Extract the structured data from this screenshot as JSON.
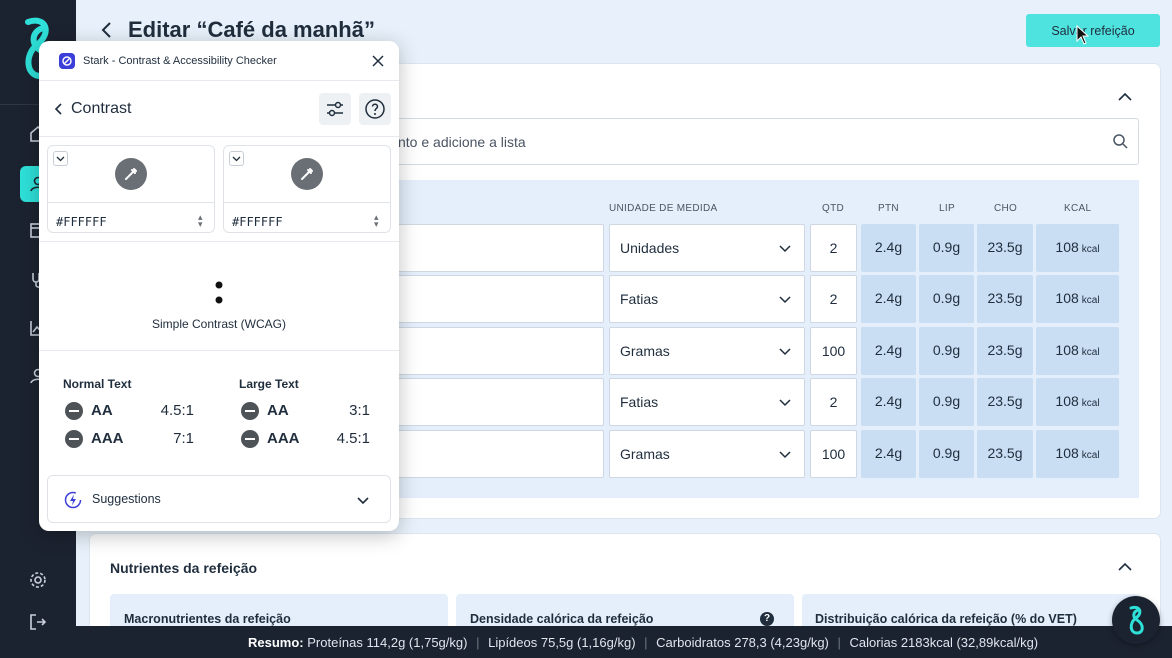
{
  "header": {
    "title": "Editar “Café da manhã”",
    "save_label": "Salvar refeição"
  },
  "search": {
    "placeholder_partial": "nto e adicione a lista"
  },
  "table": {
    "headers": {
      "unit": "UNIDADE DE MEDIDA",
      "qty": "QTD",
      "ptn": "PTN",
      "lip": "LIP",
      "cho": "CHO",
      "kcal": "KCAL"
    },
    "kcal_unit": "kcal",
    "rows": [
      {
        "unit": "Unidades",
        "qty": "2",
        "ptn": "2.4g",
        "lip": "0.9g",
        "cho": "23.5g",
        "kcal": "108"
      },
      {
        "unit": "Fatias",
        "qty": "2",
        "ptn": "2.4g",
        "lip": "0.9g",
        "cho": "23.5g",
        "kcal": "108"
      },
      {
        "unit": "Gramas",
        "qty": "100",
        "ptn": "2.4g",
        "lip": "0.9g",
        "cho": "23.5g",
        "kcal": "108"
      },
      {
        "unit": "Fatias",
        "qty": "2",
        "ptn": "2.4g",
        "lip": "0.9g",
        "cho": "23.5g",
        "kcal": "108"
      },
      {
        "unit": "Gramas",
        "qty": "100",
        "ptn": "2.4g",
        "lip": "0.9g",
        "cho": "23.5g",
        "kcal": "108"
      }
    ]
  },
  "nutrients": {
    "title": "Nutrientes da refeição",
    "cards": [
      "Macronutrientes da refeição",
      "Densidade calórica da refeição",
      "Distribuição calórica da refeição (% do VET)"
    ],
    "help": "?"
  },
  "footer": {
    "label": "Resumo:",
    "items": [
      "Proteínas 114,2g (1,75g/kg)",
      "Lipídeos 75,5g (1,16g/kg)",
      "Carboidratos 278,3 (4,23g/kg)",
      "Calorias 2183kcal (32,89kcal/kg)"
    ],
    "separator": "|"
  },
  "stark": {
    "app_title": "Stark - Contrast & Accessibility Checker",
    "section": "Contrast",
    "foreground": "#FFFFFF",
    "background": "#FFFFFF",
    "mode": "Simple Contrast (WCAG)",
    "normal": {
      "title": "Normal Text",
      "aa": "AA",
      "aa_ratio": "4.5:1",
      "aaa": "AAA",
      "aaa_ratio": "7:1"
    },
    "large": {
      "title": "Large Text",
      "aa": "AA",
      "aa_ratio": "3:1",
      "aaa": "AAA",
      "aaa_ratio": "4.5:1"
    },
    "suggestions": "Suggestions"
  },
  "colors": {
    "accent": "#2ee0d8",
    "sidebar": "#1c2330",
    "stark_brand": "#3b3fd8"
  }
}
